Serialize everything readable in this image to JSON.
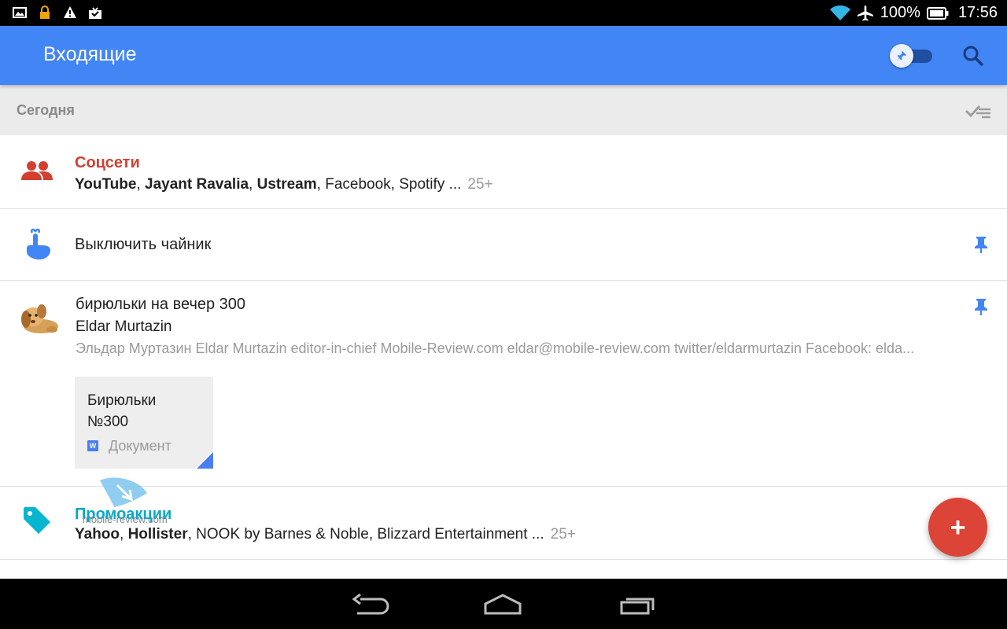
{
  "status_bar": {
    "battery": "100%",
    "time": "17:56",
    "left_icons": [
      "image-icon",
      "lock-icon",
      "warning-icon",
      "download-icon"
    ],
    "right_icons": [
      "wifi-icon",
      "airplane-icon",
      "battery-icon"
    ]
  },
  "app_bar": {
    "title": "Входящие",
    "color": "#4285f4"
  },
  "section": {
    "label": "Сегодня"
  },
  "rows": [
    {
      "type": "bundle",
      "icon": "people-icon",
      "title": "Соцсети",
      "senders_bold": [
        "YouTube",
        "Jayant Ravalia",
        "Ustream"
      ],
      "senders_normal": "Facebook, Spotify ...",
      "count": "25+",
      "accent": "#d23f31"
    },
    {
      "type": "reminder",
      "icon": "reminder-finger-icon",
      "title": "Выключить чайник",
      "pinned": true
    },
    {
      "type": "message",
      "subject": "бирюльки на вечер 300",
      "sender": "Eldar Murtazin",
      "snippet": "Эльдар Муртазин Eldar Murtazin editor-in-chief Mobile-Review.com eldar@mobile-review.com twitter/eldarmurtazin Facebook: elda...",
      "pinned": true,
      "attachment": {
        "name_line1": "Бирюльки",
        "name_line2": "№300",
        "type": "Документ"
      }
    },
    {
      "type": "bundle",
      "icon": "tag-icon",
      "title": "Промоакции",
      "senders_bold": [
        "Yahoo",
        "Hollister"
      ],
      "senders_normal": "NOOK by Barnes & Noble, Blizzard Entertainment ...",
      "count": "25+",
      "accent": "#06a9c6"
    }
  ],
  "watermark": "mobile-review.com",
  "fab": {
    "label": "+",
    "color": "#db4437"
  }
}
